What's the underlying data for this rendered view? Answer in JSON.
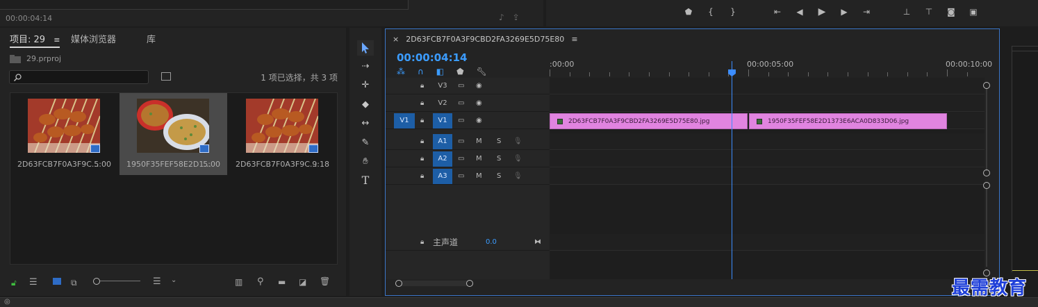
{
  "top": {
    "source_timecode": "00:00:04:14"
  },
  "project": {
    "tabs": [
      "项目: 29",
      "媒体浏览器",
      "库"
    ],
    "project_file": "29.prproj",
    "search_placeholder": "",
    "selection_status": "1 项已选择，共 3 项",
    "items": [
      {
        "name": "2D63FCB7F0A3F9C...",
        "duration": "5:00",
        "selected": false,
        "type": "image-icon"
      },
      {
        "name": "1950F35FEF58E2D1...",
        "duration": "5:00",
        "selected": true,
        "type": "image-icon"
      },
      {
        "name": "2D63FCB7F0A3F9C...",
        "duration": "9:18",
        "selected": false,
        "type": "sequence-icon"
      }
    ]
  },
  "timeline": {
    "sequence_name": "2D63FCB7F0A3F9CBD2FA3269E5D75E80",
    "timecode": "00:00:04:14",
    "ruler_labels": [
      ":00:00",
      "00:00:05:00",
      "00:00:10:00"
    ],
    "tracks": [
      {
        "label": "V3",
        "source": "",
        "kind": "video"
      },
      {
        "label": "V2",
        "source": "",
        "kind": "video"
      },
      {
        "label": "V1",
        "source": "V1",
        "kind": "video"
      },
      {
        "label": "A1",
        "source": "",
        "kind": "audio"
      },
      {
        "label": "A2",
        "source": "",
        "kind": "audio"
      },
      {
        "label": "A3",
        "source": "",
        "kind": "audio"
      }
    ],
    "master": {
      "label": "主声道",
      "value": "0.0"
    },
    "mute_label": "M",
    "solo_label": "S",
    "clips": [
      {
        "name": "2D63FCB7F0A3F9CBD2FA3269E5D75E80.jpg",
        "start": 0,
        "end": 5
      },
      {
        "name": "1950F35FEF58E2D1373E6ACA0D833D06.jpg",
        "start": 5,
        "end": 10
      }
    ],
    "playhead_seconds": 4.58
  },
  "watermark": "最需教育",
  "colors": {
    "accent": "#3b9cff",
    "clip": "#e184e0",
    "workarea": "#e8d54a"
  }
}
